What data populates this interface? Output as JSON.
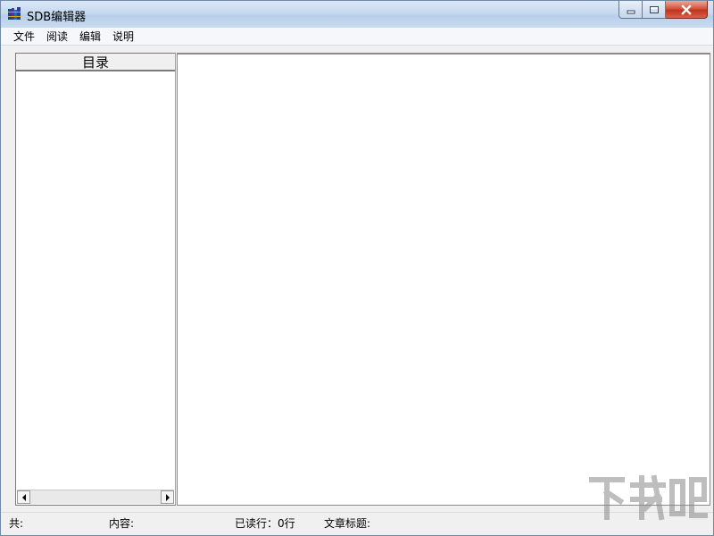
{
  "window": {
    "title": "SDB编辑器",
    "icon": "books-app-icon"
  },
  "caption_buttons": {
    "minimize": "minimize-icon",
    "maximize": "maximize-icon",
    "close": "close-icon"
  },
  "menu": {
    "items": [
      {
        "label": "文件"
      },
      {
        "label": "阅读"
      },
      {
        "label": "编辑"
      },
      {
        "label": "说明"
      }
    ]
  },
  "toc": {
    "header": "目录",
    "items": []
  },
  "content": {
    "text": ""
  },
  "status": {
    "total": "共:",
    "content": "内容:",
    "read_lines": "已读行：0行",
    "article_title": "文章标题:"
  },
  "watermark": {
    "logo": "下载吧"
  },
  "colors": {
    "close_button": "#c0331a",
    "titlebar": "#c7d9ef"
  }
}
